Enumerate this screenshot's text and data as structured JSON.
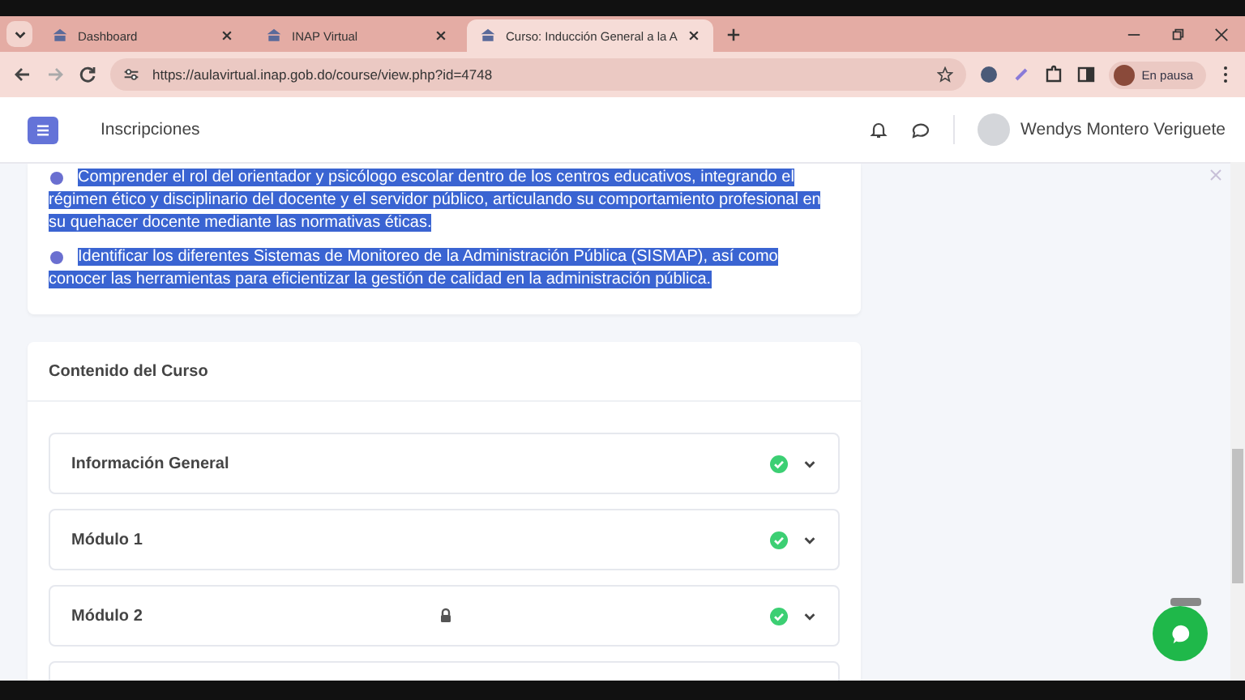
{
  "browser": {
    "tabs": [
      {
        "title": "Dashboard",
        "selected": false
      },
      {
        "title": "INAP Virtual",
        "selected": false
      },
      {
        "title": "Curso: Inducción General a la A",
        "selected": true
      }
    ],
    "url": "https://aulavirtual.inap.gob.do/course/view.php?id=4748",
    "profile_label": "En pausa"
  },
  "header": {
    "nav_label": "Inscripciones",
    "user_name": "Wendys Montero Veriguete"
  },
  "objectives": {
    "text_selected": true,
    "items": [
      "Comprender el rol del orientador y psicólogo escolar dentro de los centros educativos, integrando el régimen ético y disciplinario del docente y el servidor público, articulando su comportamiento profesional en su quehacer docente mediante las normativas éticas.",
      "Identificar los diferentes Sistemas de Monitoreo de la Administración Pública (SISMAP), así como conocer las herramientas para eficientizar la gestión de calidad en la administración pública."
    ]
  },
  "course_content": {
    "title": "Contenido del Curso",
    "sections": [
      {
        "name": "Información General",
        "locked": false,
        "completed": true
      },
      {
        "name": "Módulo 1",
        "locked": false,
        "completed": true
      },
      {
        "name": "Módulo 2",
        "locked": true,
        "completed": true
      }
    ]
  }
}
